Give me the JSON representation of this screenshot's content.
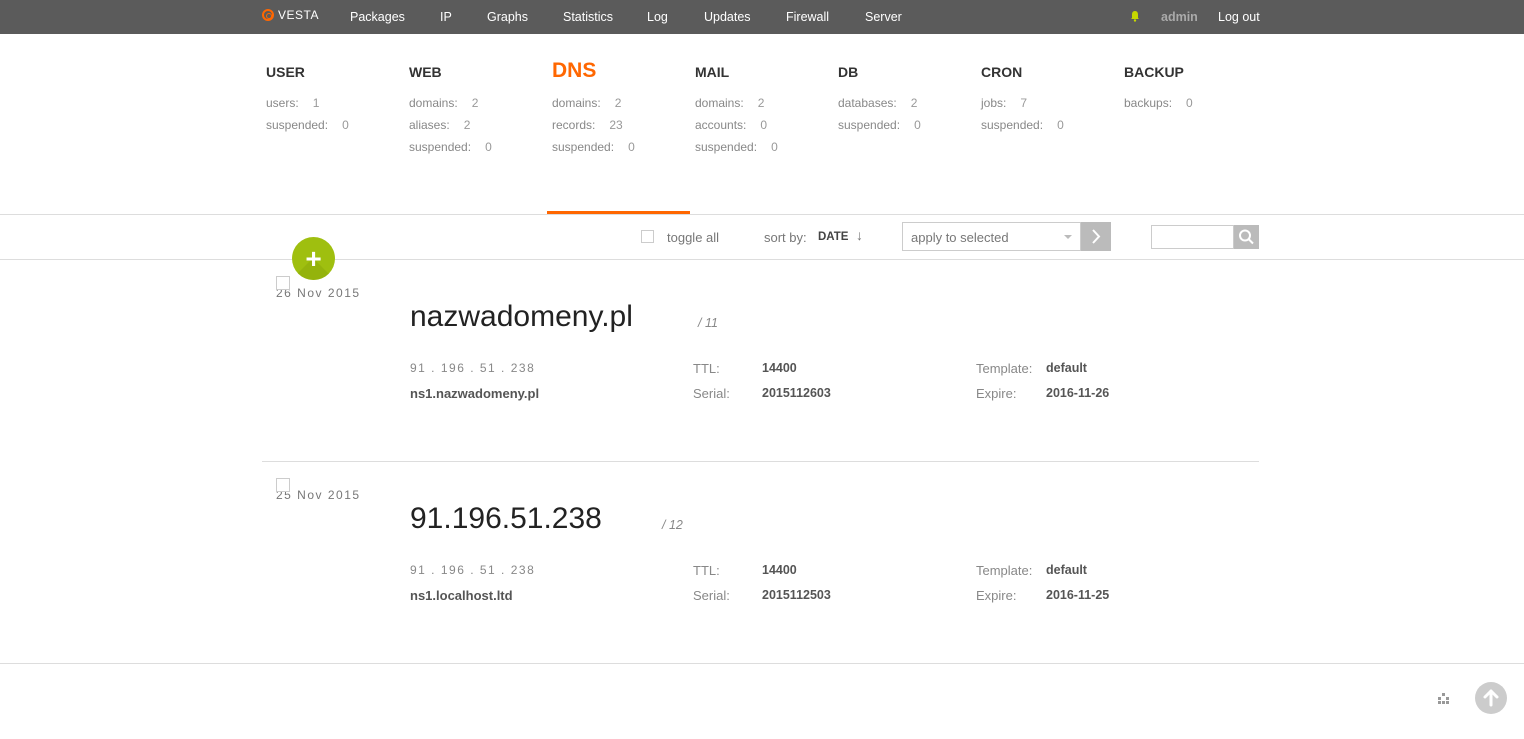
{
  "topbar": {
    "logo_text": "VESTA",
    "nav": [
      "Packages",
      "IP",
      "Graphs",
      "Statistics",
      "Log",
      "Updates",
      "Firewall",
      "Server"
    ],
    "user": "admin",
    "logout": "Log out"
  },
  "sections": [
    {
      "title": "USER",
      "stats": [
        {
          "k": "users:",
          "v": "1"
        },
        {
          "k": "suspended:",
          "v": "0"
        }
      ]
    },
    {
      "title": "WEB",
      "stats": [
        {
          "k": "domains:",
          "v": "2"
        },
        {
          "k": "aliases:",
          "v": "2"
        },
        {
          "k": "suspended:",
          "v": "0"
        }
      ]
    },
    {
      "title": "DNS",
      "stats": [
        {
          "k": "domains:",
          "v": "2"
        },
        {
          "k": "records:",
          "v": "23"
        },
        {
          "k": "suspended:",
          "v": "0"
        }
      ]
    },
    {
      "title": "MAIL",
      "stats": [
        {
          "k": "domains:",
          "v": "2"
        },
        {
          "k": "accounts:",
          "v": "0"
        },
        {
          "k": "suspended:",
          "v": "0"
        }
      ]
    },
    {
      "title": "DB",
      "stats": [
        {
          "k": "databases:",
          "v": "2"
        },
        {
          "k": "suspended:",
          "v": "0"
        }
      ]
    },
    {
      "title": "CRON",
      "stats": [
        {
          "k": "jobs:",
          "v": "7"
        },
        {
          "k": "suspended:",
          "v": "0"
        }
      ]
    },
    {
      "title": "BACKUP",
      "stats": [
        {
          "k": "backups:",
          "v": "0"
        }
      ]
    }
  ],
  "toolbar": {
    "toggle_all": "toggle all",
    "sort_by": "sort by:",
    "sort_value": "DATE",
    "sort_arrow": "↓",
    "apply_placeholder": "apply to selected",
    "add_label": "+"
  },
  "labels": {
    "ttl": "TTL:",
    "serial": "Serial:",
    "template": "Template:",
    "expire": "Expire:"
  },
  "records": [
    {
      "date": "26  Nov  2015",
      "domain": "nazwadomeny.pl",
      "count": "/ 11",
      "ip": "91 . 196 . 51 . 238",
      "ns": "ns1.nazwadomeny.pl",
      "ttl": "14400",
      "serial": "2015112603",
      "template": "default",
      "expire": "2016-11-26"
    },
    {
      "date": "25  Nov  2015",
      "domain": "91.196.51.238",
      "count": "/ 12",
      "ip": "91 . 196 . 51 . 238",
      "ns": "ns1.localhost.ltd",
      "ttl": "14400",
      "serial": "2015112503",
      "template": "default",
      "expire": "2016-11-25"
    }
  ],
  "colors": {
    "accent": "#ff6701",
    "add_button": "#9fbf0f",
    "topbar": "#5b5b5b"
  },
  "icons": [
    "vesta-logo-icon",
    "bell-icon",
    "sort-arrow-icon",
    "dropdown-caret-icon",
    "apply-arrow-icon",
    "search-icon",
    "add-icon",
    "grid-dots-icon",
    "arrow-up-icon"
  ]
}
